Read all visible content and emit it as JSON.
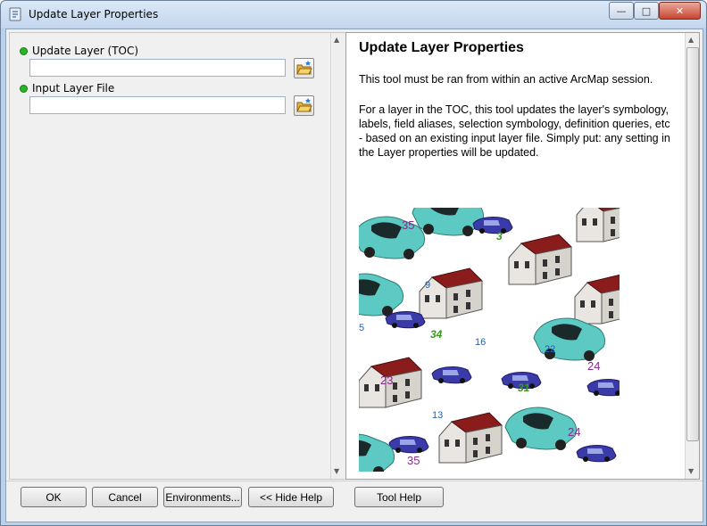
{
  "window": {
    "title": "Update Layer Properties",
    "min_glyph": "—",
    "max_glyph": "□",
    "close_glyph": "✕"
  },
  "params": [
    {
      "label": "Update Layer (TOC)",
      "value": ""
    },
    {
      "label": "Input Layer File",
      "value": ""
    }
  ],
  "help": {
    "title": "Update Layer Properties",
    "para1": "This tool must be ran from within an active ArcMap session.",
    "para2": "For a layer in the TOC, this tool updates the layer's symbology, labels, field aliases, selection symbology, definition queries, etc - based on an existing input layer file. Simply put: any setting in the Layer properties will be updated."
  },
  "illustration_labels": [
    "35",
    "3",
    "9",
    "5",
    "34",
    "16",
    "22",
    "24",
    "23",
    "31",
    "13",
    "24",
    "35"
  ],
  "buttons": {
    "ok": "OK",
    "cancel": "Cancel",
    "environments": "Environments...",
    "hide_help": "<< Hide Help",
    "tool_help": "Tool Help"
  },
  "colors": {
    "dot_green": "#29b523",
    "label_purple": "#8a2a8a",
    "label_blue": "#1f5fb0",
    "label_green": "#3a9a1a"
  }
}
